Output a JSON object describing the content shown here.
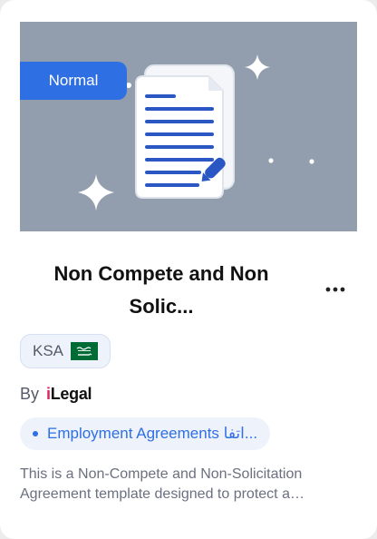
{
  "card": {
    "badge_label": "Normal",
    "title_line1": "Non Compete and Non",
    "title_line2": "Solic...",
    "more_icon": "more-horizontal-icon",
    "country": "KSA",
    "country_flag_icon": "saudi-arabia-flag-icon",
    "by_label": "By",
    "brand_prefix": "i",
    "brand_rest": "Legal",
    "category_label": "Employment Agreements اتفا...",
    "description": "This is a Non-Compete and Non-Solicitation Agreement template designed to protect a business's interests when an employee leaves.",
    "description_visible": "This is a Non-Compete and Non-Solicitation Agreement template designed to protect a…"
  },
  "colors": {
    "accent": "#2f6fe4",
    "thumbnail_bg": "#929eae",
    "brand_i": "#e0245e",
    "flag_green": "#006c35"
  }
}
